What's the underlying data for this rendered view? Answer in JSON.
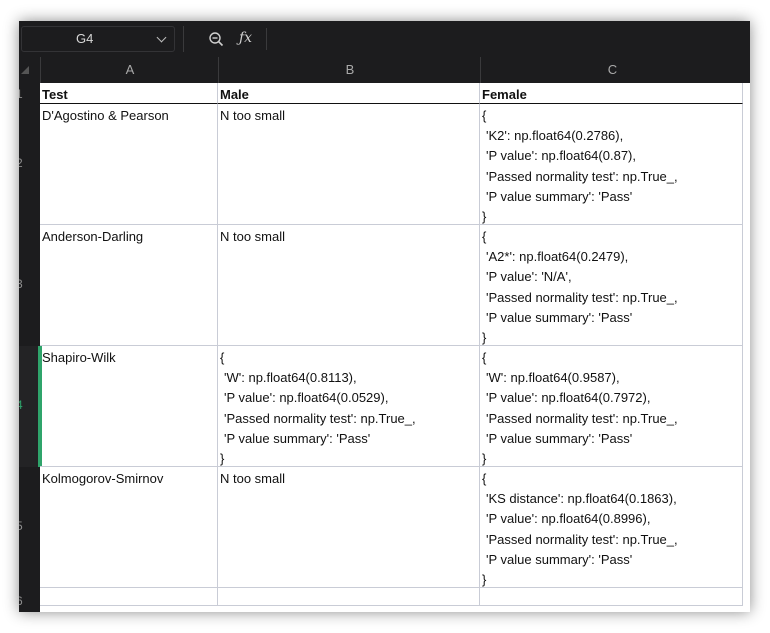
{
  "formula_bar": {
    "name_box": "G4",
    "formula_value": ""
  },
  "columns": [
    "A",
    "B",
    "C"
  ],
  "rows": [
    "1",
    "2",
    "3",
    "4",
    "5",
    "6"
  ],
  "header_row": {
    "test": "Test",
    "male": "Male",
    "female": "Female"
  },
  "table": [
    {
      "test": "D'Agostino & Pearson",
      "male": [
        "N too small"
      ],
      "female": [
        "{",
        "'K2': np.float64(0.2786),",
        "'P value': np.float64(0.87),",
        "'Passed normality test': np.True_,",
        "'P value summary': 'Pass'",
        "}"
      ]
    },
    {
      "test": "Anderson-Darling",
      "male": [
        "N too small"
      ],
      "female": [
        "{",
        "'A2*': np.float64(0.2479),",
        "'P value': 'N/A',",
        "'Passed normality test': np.True_,",
        "'P value summary': 'Pass'",
        "}"
      ]
    },
    {
      "test": "Shapiro-Wilk",
      "male": [
        "{",
        "'W': np.float64(0.8113),",
        "'P value': np.float64(0.0529),",
        "'Passed normality test': np.True_,",
        "'P value summary': 'Pass'",
        "}"
      ],
      "female": [
        "{",
        "'W': np.float64(0.9587),",
        "'P value': np.float64(0.7972),",
        "'Passed normality test': np.True_,",
        "'P value summary': 'Pass'",
        "}"
      ]
    },
    {
      "test": "Kolmogorov-Smirnov",
      "male": [
        "N too small"
      ],
      "female": [
        "{",
        "'KS distance': np.float64(0.1863),",
        "'P value': np.float64(0.8996),",
        "'Passed normality test': np.True_,",
        "'P value summary': 'Pass'",
        "}"
      ]
    }
  ],
  "selected_row": "4",
  "colors": {
    "accent": "#2fa46b",
    "toolbar_bg": "#1c1c1e",
    "gridline": "#c9ccd6"
  }
}
